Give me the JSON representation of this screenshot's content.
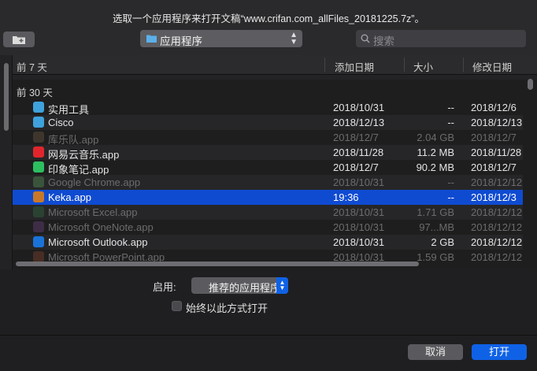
{
  "window": {
    "title": "选取一个应用程序来打开文稿“www.crifan.com_allFiles_20181225.7z”。"
  },
  "toolbar": {
    "new_folder_icon": "new-folder-icon",
    "location_label": "应用程序",
    "search_placeholder": "搜索"
  },
  "columns": {
    "name": "前 7 天",
    "added": "添加日期",
    "size": "大小",
    "modified": "修改日期"
  },
  "group_title": "前 30 天",
  "rows": [
    {
      "name": "实用工具",
      "added": "2018/10/31",
      "size": "--",
      "modified": "2018/12/6",
      "state": "normal",
      "icon": "utilities-folder-icon",
      "color": "#3fa2dc"
    },
    {
      "name": "Cisco",
      "added": "2018/12/13",
      "size": "--",
      "modified": "2018/12/13",
      "state": "normal",
      "icon": "folder-icon",
      "color": "#3fa2dc"
    },
    {
      "name": "库乐队.app",
      "added": "2018/12/7",
      "size": "2.04 GB",
      "modified": "2018/12/7",
      "state": "dim",
      "icon": "garageband-icon",
      "color": "#5a4a3a"
    },
    {
      "name": "网易云音乐.app",
      "added": "2018/11/28",
      "size": "11.2 MB",
      "modified": "2018/11/28",
      "state": "normal",
      "icon": "netease-music-icon",
      "color": "#e0262c"
    },
    {
      "name": "印象笔记.app",
      "added": "2018/12/7",
      "size": "90.2 MB",
      "modified": "2018/12/7",
      "state": "normal",
      "icon": "evernote-icon",
      "color": "#2dbe60"
    },
    {
      "name": "Google Chrome.app",
      "added": "2018/10/31",
      "size": "--",
      "modified": "2018/12/12",
      "state": "dim",
      "icon": "chrome-icon",
      "color": "#4a7a4a"
    },
    {
      "name": "Keka.app",
      "added": "19:36",
      "size": "--",
      "modified": "2018/12/3",
      "state": "selected",
      "icon": "keka-icon",
      "color": "#c8782a"
    },
    {
      "name": "Microsoft Excel.app",
      "added": "2018/10/31",
      "size": "1.71 GB",
      "modified": "2018/12/12",
      "state": "dim",
      "icon": "excel-icon",
      "color": "#2d5a3a"
    },
    {
      "name": "Microsoft OneNote.app",
      "added": "2018/10/31",
      "size": "97...MB",
      "modified": "2018/12/12",
      "state": "dim",
      "icon": "onenote-icon",
      "color": "#5a3a6a"
    },
    {
      "name": "Microsoft Outlook.app",
      "added": "2018/10/31",
      "size": "2 GB",
      "modified": "2018/12/12",
      "state": "normal",
      "icon": "outlook-icon",
      "color": "#1a73d9"
    },
    {
      "name": "Microsoft PowerPoint.app",
      "added": "2018/10/31",
      "size": "1.59 GB",
      "modified": "2018/12/12",
      "state": "dim",
      "icon": "powerpoint-icon",
      "color": "#6a3a2a"
    }
  ],
  "footer": {
    "enable_label": "启用:",
    "enable_value": "推荐的应用程序",
    "always_open_label": "始终以此方式打开",
    "cancel_label": "取消",
    "open_label": "打开"
  }
}
